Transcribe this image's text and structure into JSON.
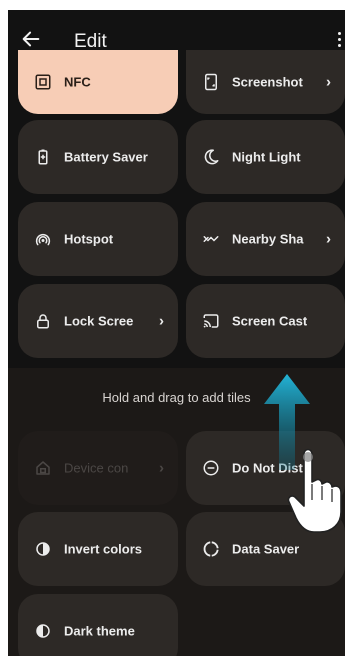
{
  "header": {
    "title": "Edit",
    "back_icon": "arrow-left-icon",
    "menu_icon": "more-vert-icon"
  },
  "active_tiles": [
    {
      "label": "NFC",
      "icon": "nfc-icon",
      "highlight": true,
      "chevron": false
    },
    {
      "label": "Screenshot",
      "icon": "screenshot-icon",
      "highlight": false,
      "chevron": true
    },
    {
      "label": "Battery Saver",
      "icon": "battery-icon",
      "chevron": false
    },
    {
      "label": "Night Light",
      "icon": "moon-icon",
      "chevron": false
    },
    {
      "label": "Hotspot",
      "icon": "hotspot-icon",
      "chevron": false
    },
    {
      "label": "Nearby Sha",
      "icon": "nearby-share-icon",
      "chevron": true
    },
    {
      "label": "Lock Scree",
      "icon": "lock-icon",
      "chevron": true
    },
    {
      "label": "Screen Cast",
      "icon": "cast-icon",
      "chevron": false
    }
  ],
  "hint_text": "Hold and drag to add tiles",
  "available_tiles": [
    {
      "label": "Device con",
      "icon": "home-device-icon",
      "disabled": true,
      "chevron": true
    },
    {
      "label": "Do Not Distu",
      "icon": "do-not-disturb-icon",
      "chevron": false
    },
    {
      "label": "Invert colors",
      "icon": "invert-colors-icon",
      "chevron": false
    },
    {
      "label": "Data Saver",
      "icon": "data-saver-icon",
      "chevron": false
    },
    {
      "label": "Dark theme",
      "icon": "dark-theme-icon",
      "chevron": false
    }
  ],
  "colors": {
    "background": "#121212",
    "tile": "#2d2926",
    "tile_highlight": "#f7cdb6",
    "gesture_arrow": "#1aa3c8"
  },
  "gesture": {
    "arrow_icon": "drag-up-arrow-icon",
    "hand_icon": "hand-pointer-icon"
  }
}
